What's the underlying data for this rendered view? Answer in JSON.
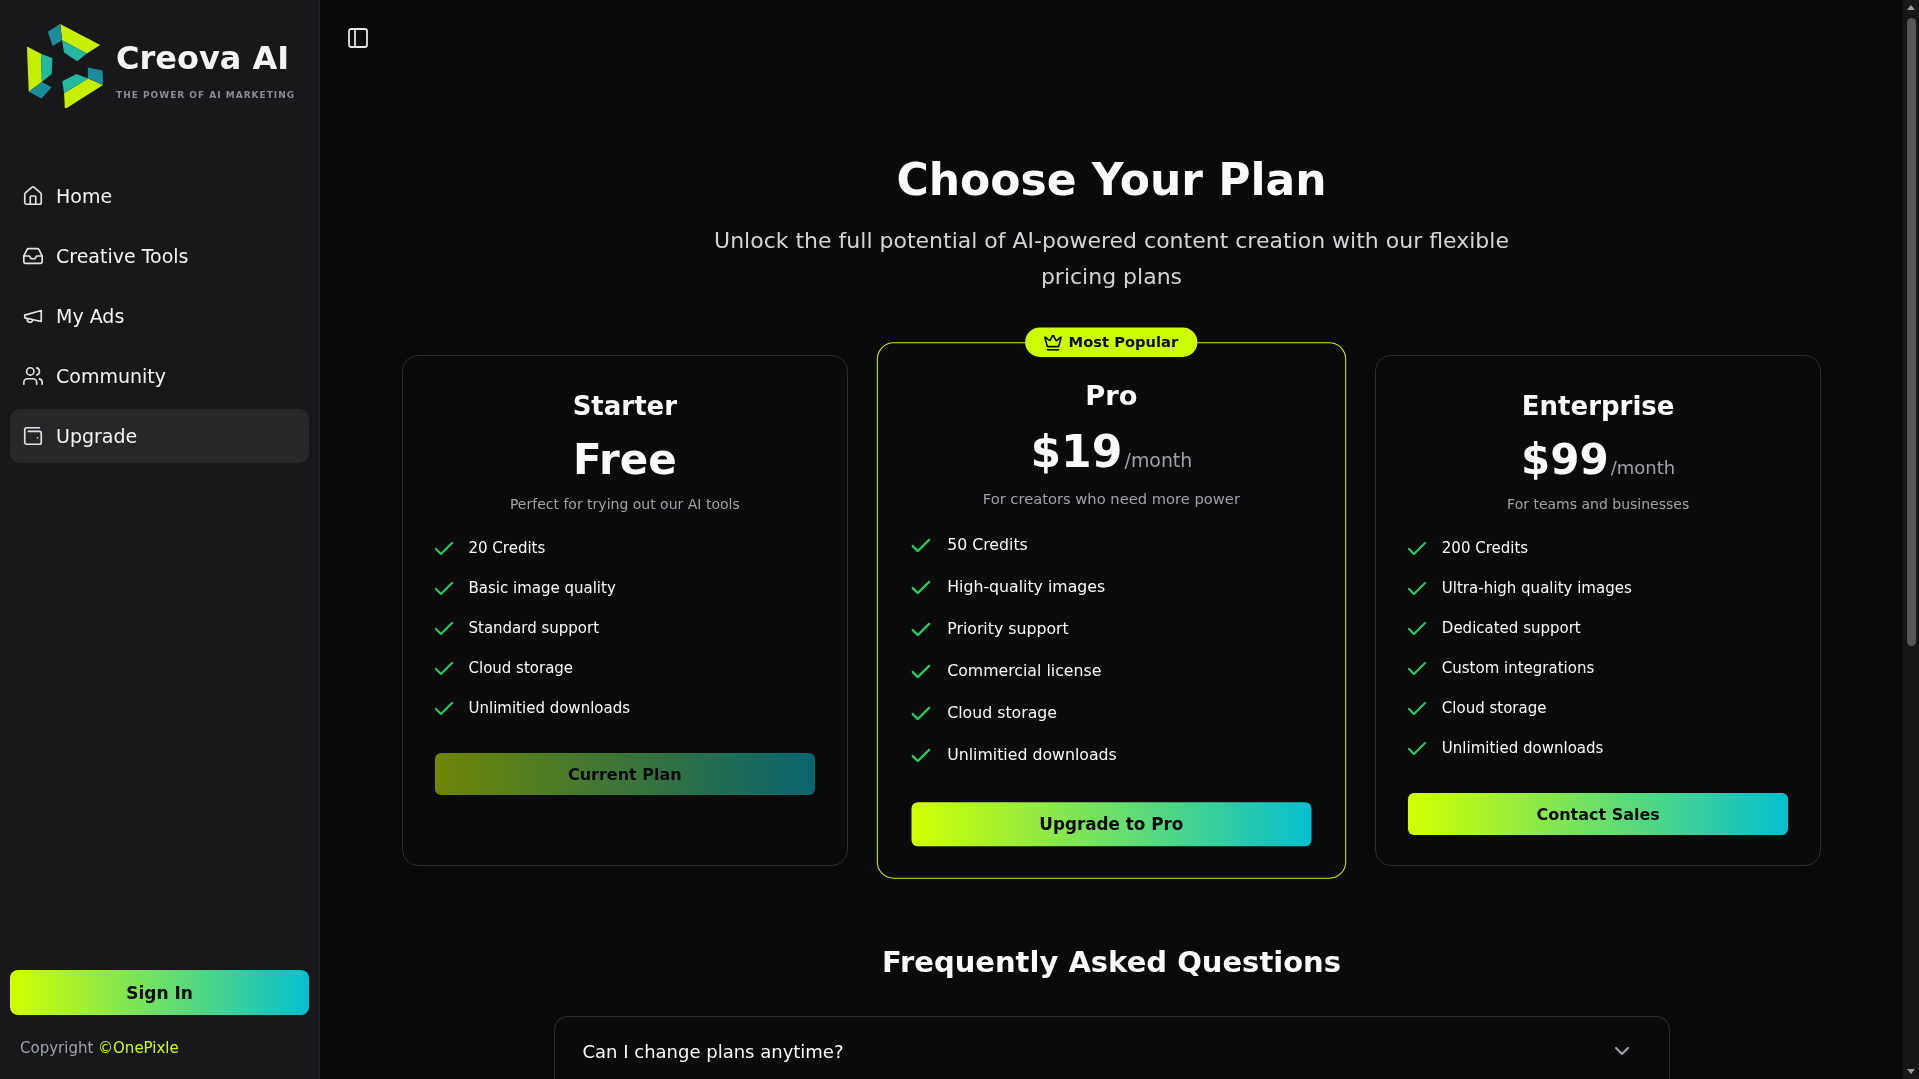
{
  "sidebar": {
    "brand": {
      "name": "Creova AI",
      "tagline": "THE POWER OF AI MARKETING"
    },
    "nav": [
      {
        "label": "Home",
        "selected": false
      },
      {
        "label": "Creative Tools",
        "selected": false
      },
      {
        "label": "My Ads",
        "selected": false
      },
      {
        "label": "Community",
        "selected": false
      },
      {
        "label": "Upgrade",
        "selected": true
      }
    ],
    "sign_in_button": "Sign In",
    "copyright": {
      "text": "Copyright",
      "link": "©OnePixle"
    }
  },
  "header": {
    "title": "Choose Your Plan",
    "subtitle": "Unlock the full potential of AI-powered content creation with our flexible pricing plans"
  },
  "plans": [
    {
      "name": "Starter",
      "price": "Free",
      "description": "Perfect for trying out our AI tools",
      "featured": false,
      "features": [
        "20 Credits",
        "Basic image quality",
        "Standard support",
        "Cloud storage",
        "Unlimitied downloads"
      ],
      "button": {
        "label": "Current Plan",
        "disabled": true
      }
    },
    {
      "name": "Pro",
      "badge": "Most Popular",
      "price": "$19",
      "period": "/month",
      "description": "For creators who need more power",
      "featured": true,
      "features": [
        "50 Credits",
        "High-quality images",
        "Priority support",
        "Commercial license",
        "Cloud storage",
        "Unlimitied downloads"
      ],
      "button": {
        "label": "Upgrade to Pro",
        "disabled": false
      }
    },
    {
      "name": "Enterprise",
      "price": "$99",
      "period": "/month",
      "description": "For teams and businesses",
      "featured": false,
      "features": [
        "200 Credits",
        "Ultra-high quality images",
        "Dedicated support",
        "Custom integrations",
        "Cloud storage",
        "Unlimitied downloads"
      ],
      "button": {
        "label": "Contact Sales",
        "disabled": false
      }
    }
  ],
  "faq": {
    "title": "Frequently Asked Questions",
    "items": [
      {
        "question": "Can I change plans anytime?",
        "expanded": false
      }
    ]
  }
}
